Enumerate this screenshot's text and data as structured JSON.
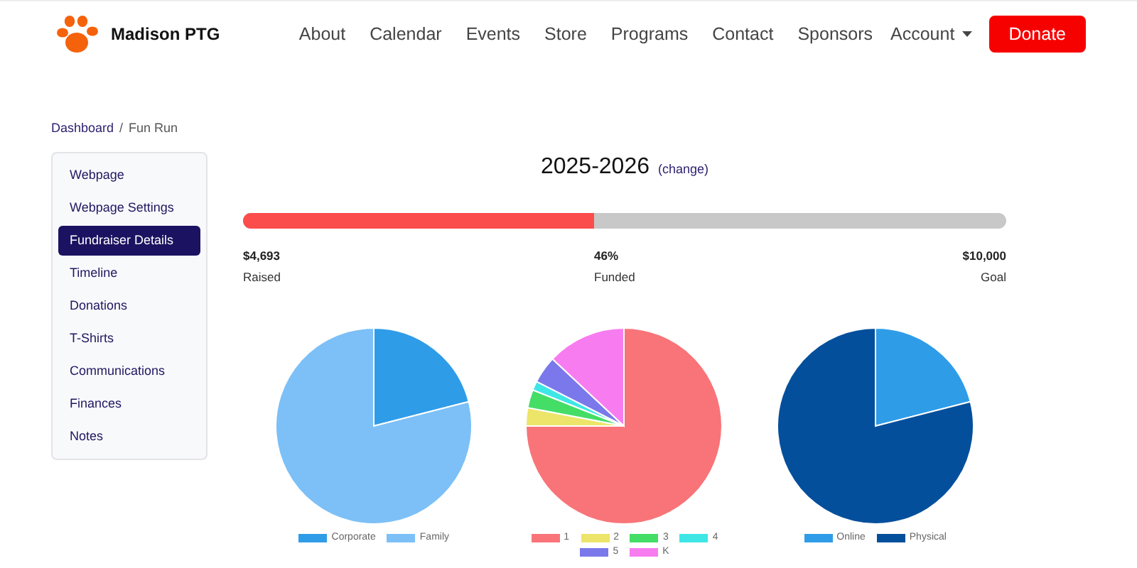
{
  "header": {
    "brand": "Madison PTG",
    "nav": [
      "About",
      "Calendar",
      "Events",
      "Store",
      "Programs",
      "Contact",
      "Sponsors"
    ],
    "account": "Account",
    "donate": "Donate"
  },
  "breadcrumb": {
    "parent": "Dashboard",
    "separator": "/",
    "current": "Fun Run"
  },
  "sidebar": {
    "items": [
      {
        "label": "Webpage",
        "selected": false
      },
      {
        "label": "Webpage Settings",
        "selected": false
      },
      {
        "label": "Fundraiser Details",
        "selected": true
      },
      {
        "label": "Timeline",
        "selected": false
      },
      {
        "label": "Donations",
        "selected": false
      },
      {
        "label": "T-Shirts",
        "selected": false
      },
      {
        "label": "Communications",
        "selected": false
      },
      {
        "label": "Finances",
        "selected": false
      },
      {
        "label": "Notes",
        "selected": false
      }
    ]
  },
  "season": {
    "title": "2025-2026",
    "change": "(change)"
  },
  "progress": {
    "level": 0.46,
    "raised": "$4,693",
    "raised_label": "Raised",
    "funded": "46%",
    "funded_label": "Funded",
    "goal": "$10,000",
    "goal_label": "Goal"
  },
  "pies": [
    {
      "kind": "picture",
      "legend": [
        {
          "label": "Corporate",
          "color": "#2f9ce8"
        },
        {
          "label": "Family",
          "color": "#7cc0f7"
        }
      ]
    },
    {
      "kind": "picture",
      "legend": [
        {
          "label": "1",
          "color": "#f87478"
        },
        {
          "label": "2",
          "color": "#ede46a"
        },
        {
          "label": "3",
          "color": "#44dd66"
        },
        {
          "label": "4",
          "color": "#3ee6e6"
        },
        {
          "label": "5",
          "color": "#7a78ea"
        },
        {
          "label": "K",
          "color": "#f77cf0"
        }
      ]
    },
    {
      "kind": "picture",
      "legend": [
        {
          "label": "Online",
          "color": "#2f9ce8"
        },
        {
          "label": "Physical",
          "color": "#044f9c"
        }
      ]
    }
  ]
}
